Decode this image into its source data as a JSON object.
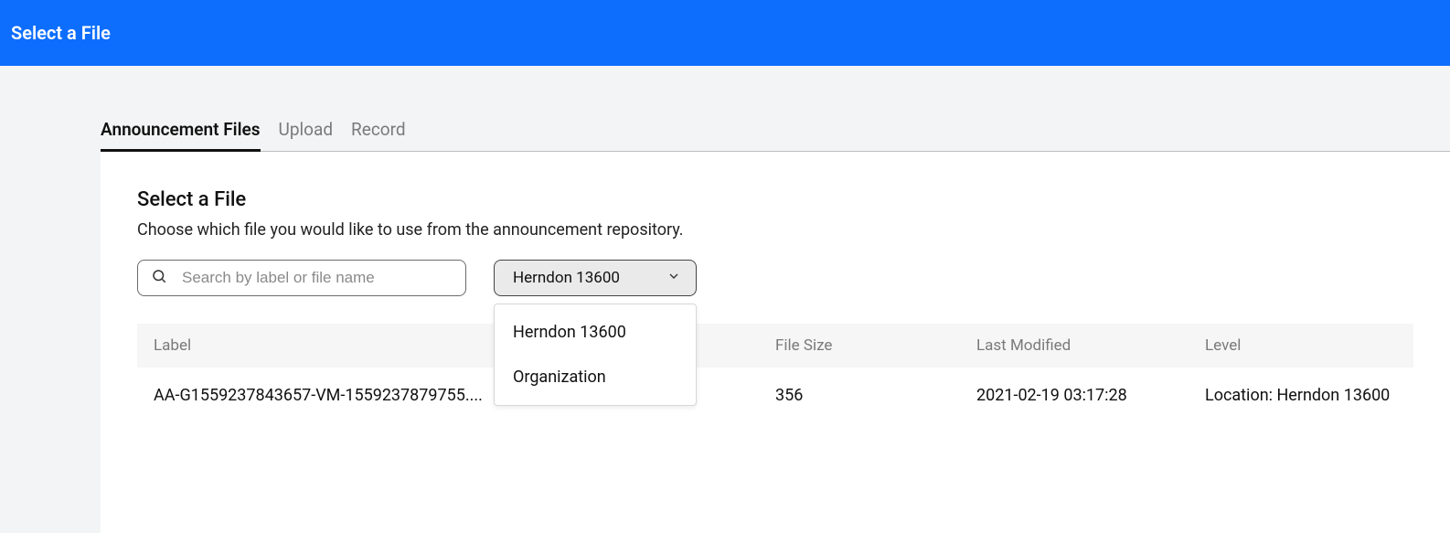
{
  "topbar": {
    "title": "Select a File"
  },
  "tabs": [
    {
      "label": "Announcement Files",
      "active": true
    },
    {
      "label": "Upload",
      "active": false
    },
    {
      "label": "Record",
      "active": false
    }
  ],
  "panel": {
    "heading": "Select a File",
    "description": "Choose which file you would like to use from the announcement repository."
  },
  "search": {
    "placeholder": "Search by label or file name",
    "value": ""
  },
  "filter": {
    "selected": "Herndon 13600",
    "options": [
      "Herndon 13600",
      "Organization"
    ]
  },
  "table": {
    "columns": {
      "label": "Label",
      "size": "File Size",
      "modified": "Last Modified",
      "level": "Level"
    },
    "rows": [
      {
        "label": "AA-G1559237843657-VM-1559237879755....",
        "size": "356",
        "modified": "2021-02-19 03:17:28",
        "level": "Location: Herndon 13600"
      }
    ]
  }
}
